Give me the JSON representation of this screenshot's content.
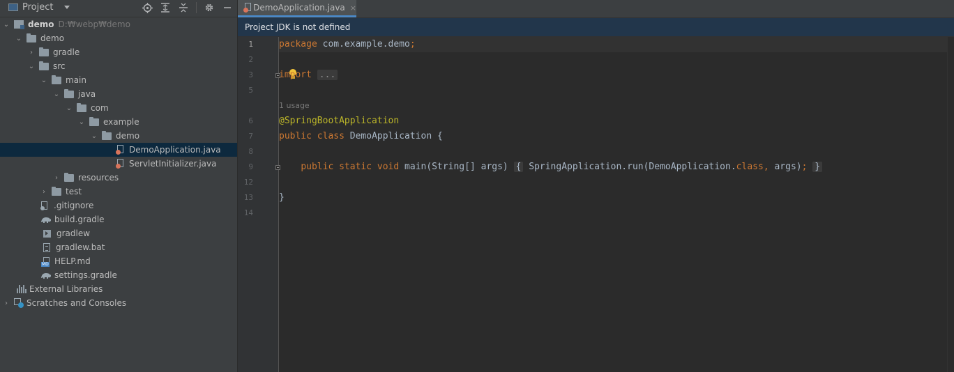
{
  "project_panel": {
    "title": "Project",
    "tools": [
      "locate-icon",
      "expand-all-icon",
      "collapse-all-icon",
      "gear-icon",
      "minimize-icon"
    ],
    "tree": [
      {
        "label": "demo",
        "path": "D:₩webp₩demo",
        "depth": 0,
        "expanded": true,
        "icon": "module-icon",
        "bold": true
      },
      {
        "label": "demo",
        "depth": 1,
        "expanded": true,
        "icon": "folder-icon"
      },
      {
        "label": "gradle",
        "depth": 2,
        "expanded": false,
        "icon": "folder-icon"
      },
      {
        "label": "src",
        "depth": 2,
        "expanded": true,
        "icon": "folder-icon"
      },
      {
        "label": "main",
        "depth": 3,
        "expanded": true,
        "icon": "folder-icon"
      },
      {
        "label": "java",
        "depth": 4,
        "expanded": true,
        "icon": "folder-icon"
      },
      {
        "label": "com",
        "depth": 5,
        "expanded": true,
        "icon": "folder-icon"
      },
      {
        "label": "example",
        "depth": 6,
        "expanded": true,
        "icon": "folder-icon"
      },
      {
        "label": "demo",
        "depth": 7,
        "expanded": true,
        "icon": "folder-icon"
      },
      {
        "label": "DemoApplication.java",
        "depth": 8,
        "icon": "java-class-icon",
        "selected": true
      },
      {
        "label": "ServletInitializer.java",
        "depth": 8,
        "icon": "java-class-icon"
      },
      {
        "label": "resources",
        "depth": 4,
        "expanded": false,
        "icon": "folder-icon"
      },
      {
        "label": "test",
        "depth": 3,
        "expanded": false,
        "icon": "folder-icon"
      },
      {
        "label": ".gitignore",
        "depth": 2,
        "icon": "gitignore-icon"
      },
      {
        "label": "build.gradle",
        "depth": 2,
        "icon": "gradle-icon"
      },
      {
        "label": "gradlew",
        "depth": 2,
        "icon": "shell-script-icon"
      },
      {
        "label": "gradlew.bat",
        "depth": 2,
        "icon": "text-file-icon"
      },
      {
        "label": "HELP.md",
        "depth": 2,
        "icon": "markdown-icon"
      },
      {
        "label": "settings.gradle",
        "depth": 2,
        "icon": "gradle-icon"
      },
      {
        "label": "External Libraries",
        "depth": 0,
        "icon": "libraries-icon"
      },
      {
        "label": "Scratches and Consoles",
        "depth": 0,
        "expanded": false,
        "icon": "scratches-icon"
      }
    ]
  },
  "editor": {
    "tab": {
      "label": "DemoApplication.java",
      "close": "×"
    },
    "banner": "Project JDK is not defined",
    "line_numbers": [
      "1",
      "2",
      "3",
      "5",
      "",
      "6",
      "7",
      "8",
      "9",
      "12",
      "13",
      "14"
    ],
    "lines": {
      "l1_kw": "package",
      "l1_pkg": " com.example.demo",
      "l1_semi": ";",
      "l3_kw": "import",
      "l3_fold": "...",
      "usage_hint": "1 usage",
      "l6_ann": "@SpringBootApplication",
      "l7_kw1": "public",
      "l7_kw2": "class",
      "l7_name": " DemoApplication {",
      "l9_kw1": "public",
      "l9_kw2": "static",
      "l9_kw3": "void",
      "l9_sig": " main(String[] args)",
      "l9_open": "{",
      "l9_body1": " SpringApplication.run(DemoApplication.",
      "l9_class_kw": "class",
      "l9_comma": ",",
      "l9_body2": " args)",
      "l9_semi": ";",
      "l9_close": "}",
      "l13": "}"
    }
  },
  "colors": {
    "keyword": "#cc7832",
    "annotation": "#bbb529",
    "text": "#a9b7c6",
    "selection": "#0d293e",
    "banner_bg": "#22364b",
    "tab_underline": "#4a88c7"
  }
}
